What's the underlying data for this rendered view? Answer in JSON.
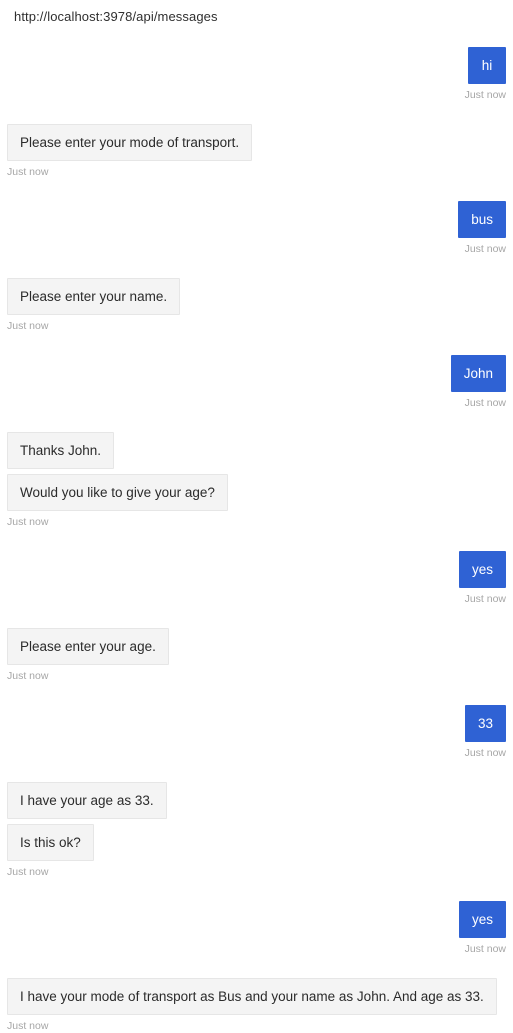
{
  "endpoint": {
    "url": "http://localhost:3978/api/messages"
  },
  "colors": {
    "user_bubble": "#2f62d4",
    "user_text": "#ffffff",
    "bot_bubble": "#f4f4f4",
    "bot_border": "#e6e6e6",
    "bot_text": "#2b2b2b",
    "timestamp": "#a6a6a6",
    "page_background": "#ffffff"
  },
  "transcript": {
    "groups": [
      {
        "from": "user",
        "timestamp": "Just now",
        "messages": [
          {
            "text": "hi"
          }
        ]
      },
      {
        "from": "bot",
        "timestamp": "Just now",
        "messages": [
          {
            "text": "Please enter your mode of transport."
          }
        ]
      },
      {
        "from": "user",
        "timestamp": "Just now",
        "messages": [
          {
            "text": "bus"
          }
        ]
      },
      {
        "from": "bot",
        "timestamp": "Just now",
        "messages": [
          {
            "text": "Please enter your name."
          }
        ]
      },
      {
        "from": "user",
        "timestamp": "Just now",
        "messages": [
          {
            "text": "John"
          }
        ]
      },
      {
        "from": "bot",
        "timestamp": "Just now",
        "messages": [
          {
            "text": "Thanks John."
          },
          {
            "text": "Would you like to give your age?"
          }
        ]
      },
      {
        "from": "user",
        "timestamp": "Just now",
        "messages": [
          {
            "text": "yes"
          }
        ]
      },
      {
        "from": "bot",
        "timestamp": "Just now",
        "messages": [
          {
            "text": "Please enter your age."
          }
        ]
      },
      {
        "from": "user",
        "timestamp": "Just now",
        "messages": [
          {
            "text": "33"
          }
        ]
      },
      {
        "from": "bot",
        "timestamp": "Just now",
        "messages": [
          {
            "text": "I have your age as 33."
          },
          {
            "text": "Is this ok?"
          }
        ]
      },
      {
        "from": "user",
        "timestamp": "Just now",
        "messages": [
          {
            "text": "yes"
          }
        ]
      },
      {
        "from": "bot",
        "timestamp": "Just now",
        "messages": [
          {
            "text": "I have your mode of transport as Bus and your name as John. And age as 33."
          }
        ]
      }
    ]
  }
}
